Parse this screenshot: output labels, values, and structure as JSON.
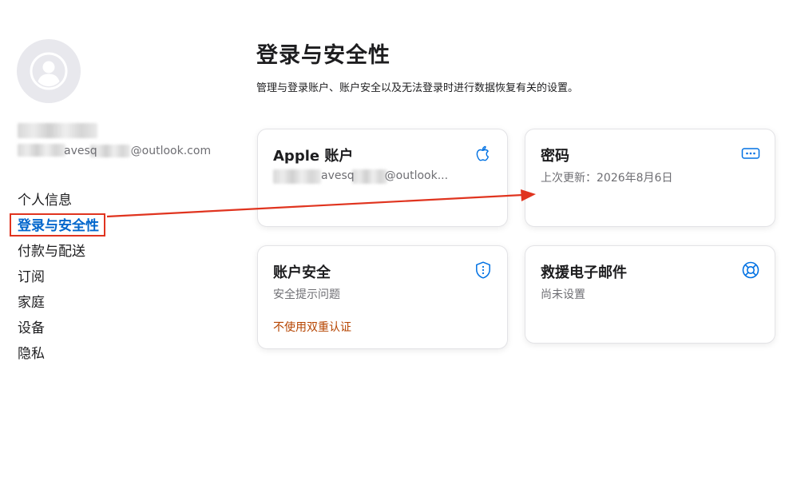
{
  "sidebar": {
    "user_email_fragment": "avesq",
    "user_email_domain": "@outlook.com",
    "items": [
      {
        "label": "个人信息"
      },
      {
        "label": "登录与安全性",
        "active": true
      },
      {
        "label": "付款与配送"
      },
      {
        "label": "订阅"
      },
      {
        "label": "家庭"
      },
      {
        "label": "设备"
      },
      {
        "label": "隐私"
      }
    ]
  },
  "main": {
    "title": "登录与安全性",
    "subtitle": "管理与登录账户、账户安全以及无法登录时进行数据恢复有关的设置。",
    "cards": {
      "apple": {
        "title": "Apple 账户",
        "email_fragment": "avesq",
        "email_domain": "@outlook...",
        "icon": "apple-icon"
      },
      "password": {
        "title": "密码",
        "subtitle": "上次更新：2026年8月6日",
        "icon": "dots-icon"
      },
      "security": {
        "title": "账户安全",
        "subtitle": "安全提示问题",
        "warning": "不使用双重认证",
        "icon": "shield-icon"
      },
      "rescue": {
        "title": "救援电子邮件",
        "subtitle": "尚未设置",
        "icon": "lifebuoy-icon"
      }
    }
  },
  "colors": {
    "accent": "#0066cc",
    "warning": "#b64400",
    "annotation": "#e0341f"
  }
}
